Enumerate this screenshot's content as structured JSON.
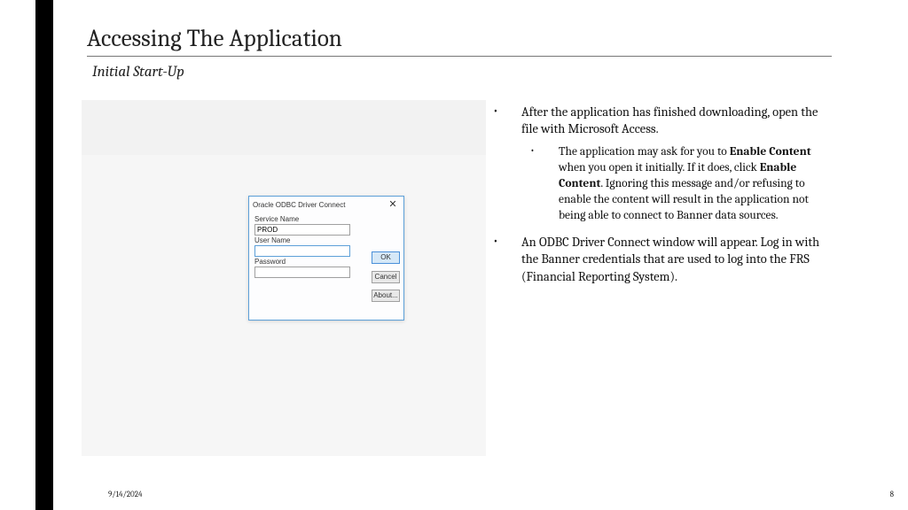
{
  "slide": {
    "title": "Accessing The Application",
    "subtitle": "Initial Start-Up"
  },
  "dialog": {
    "title": "Oracle ODBC Driver Connect",
    "close": "✕",
    "service_label": "Service Name",
    "service_value": "PROD",
    "user_label": "User Name",
    "user_value": "",
    "password_label": "Password",
    "password_value": "",
    "ok": "OK",
    "cancel": "Cancel",
    "about": "About..."
  },
  "bullets": {
    "b1": "After the application has finished downloading, open the file with Microsoft Access.",
    "b1a_pre": "The application may ask for you to ",
    "b1a_bold1": "Enable Content",
    "b1a_mid": " when you open it initially.  If it does, click ",
    "b1a_bold2": "Enable Content",
    "b1a_post": ". Ignoring this message and/or refusing to enable the content will result in the application not being able to connect to Banner data sources.",
    "b2": "An ODBC Driver Connect window will appear. Log in with the Banner credentials that are used to log into the FRS (Financial Reporting System)."
  },
  "footer": {
    "date": "9/14/2024",
    "page": "8"
  }
}
